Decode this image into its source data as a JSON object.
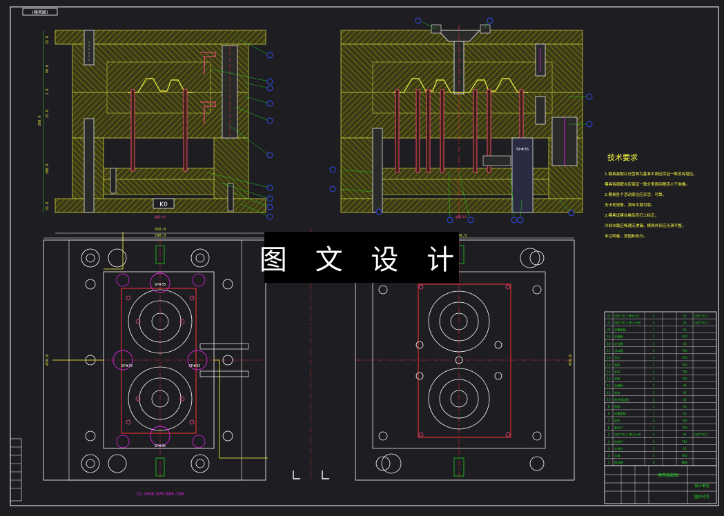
{
  "sheet": {
    "corner_tag": "(模具图)",
    "overlay_watermark": "图 文 设 计",
    "bottom_part_code": "CI-2040-A70-B80-C90",
    "center_marker": "K0"
  },
  "section_views": {
    "left_caption": "剖面 A-A",
    "right_caption": "剖面 B-B",
    "right_label_sp": "SP#35",
    "left_dims": [
      "25.0",
      "80.0",
      "1.0",
      "25.0",
      "200.0",
      "100.0",
      "25.0"
    ]
  },
  "plan_views": {
    "left_width_outer": "350.0",
    "left_width_inner": "290.0",
    "right_width_outer": "290.0",
    "left_height": "450.0",
    "right_height": "450.0",
    "sp_labels": [
      "SP#35",
      "SP#35",
      "SP#35",
      "SP#35"
    ]
  },
  "tech_requirements": {
    "title": "技术要求",
    "lines": [
      "1.模具装配以分型面为基准平面应保证一致没有错位。",
      "  模具各面配合应保证一致分型面间隙应小于准确。",
      "2.模具各个活动部位应灵活、可靠，",
      "  无卡死现象。顶出平稳可靠。",
      "3.模具试模合格后应打上标记，",
      "  冷却水路应畅通无渗漏。模具外形应光滑平整。",
      "  未注明者，按国标执行。"
    ]
  },
  "bom": {
    "headers": [
      "序号",
      "名称",
      "数量",
      "材料",
      "备注"
    ],
    "rows": [
      {
        "no": "22",
        "name": "GB/T70.1 M8×25",
        "qty": "4",
        "mat": "45",
        "note": "GB/T70.1"
      },
      {
        "no": "21",
        "name": "GB/T70.1 M12×60",
        "qty": "4",
        "mat": "45",
        "note": "GB/T70.1"
      },
      {
        "no": "20",
        "name": "定模座板",
        "qty": "1",
        "mat": "45",
        "note": ""
      },
      {
        "no": "19",
        "name": "定模板",
        "qty": "1",
        "mat": "P20",
        "note": ""
      },
      {
        "no": "18",
        "name": "定位圈",
        "qty": "1",
        "mat": "45",
        "note": ""
      },
      {
        "no": "17",
        "name": "浇口套",
        "qty": "1",
        "mat": "T8A",
        "note": ""
      },
      {
        "no": "16",
        "name": "型芯",
        "qty": "2",
        "mat": "P20",
        "note": ""
      },
      {
        "no": "15",
        "name": "型腔",
        "qty": "2",
        "mat": "P20",
        "note": ""
      },
      {
        "no": "14",
        "name": "导柱",
        "qty": "4",
        "mat": "T8A",
        "note": ""
      },
      {
        "no": "13",
        "name": "导套",
        "qty": "4",
        "mat": "T8A",
        "note": ""
      },
      {
        "no": "12",
        "name": "动模板",
        "qty": "1",
        "mat": "45",
        "note": ""
      },
      {
        "no": "11",
        "name": "垫块",
        "qty": "2",
        "mat": "45",
        "note": ""
      },
      {
        "no": "10",
        "name": "推杆固定板",
        "qty": "1",
        "mat": "45",
        "note": ""
      },
      {
        "no": "9",
        "name": "推板",
        "qty": "1",
        "mat": "45",
        "note": ""
      },
      {
        "no": "8",
        "name": "动模座板",
        "qty": "1",
        "mat": "45",
        "note": ""
      },
      {
        "no": "7",
        "name": "推杆",
        "qty": "8",
        "mat": "T8A",
        "note": ""
      },
      {
        "no": "6",
        "name": "复位杆",
        "qty": "4",
        "mat": "T8A",
        "note": ""
      },
      {
        "no": "5",
        "name": "GB/T70.1 M10×90",
        "qty": "4",
        "mat": "45",
        "note": "GB/T70.1"
      },
      {
        "no": "4",
        "name": "拉料杆",
        "qty": "1",
        "mat": "T8A",
        "note": ""
      },
      {
        "no": "3",
        "name": "支承柱",
        "qty": "2",
        "mat": "45",
        "note": ""
      },
      {
        "no": "2",
        "name": "水嘴",
        "qty": "4",
        "mat": "H62",
        "note": ""
      },
      {
        "no": "1",
        "name": "密封圈",
        "qty": "8",
        "mat": "橡胶",
        "note": ""
      }
    ]
  },
  "title_block": {
    "drawing_name": "模具装配图",
    "company": "设计单位",
    "drawing_no": "图样代号"
  },
  "colors": {
    "background": "#1e1e22",
    "frame": "#ffffff",
    "hatch": "#c8c800",
    "pink": "#ff4d8a",
    "magenta": "#e020e0",
    "red_center": "#ff3030",
    "cyan": "#20c0e0",
    "blue_balloon": "#3050ff",
    "green_table": "#20d020",
    "yellow_text": "#ffff40"
  }
}
